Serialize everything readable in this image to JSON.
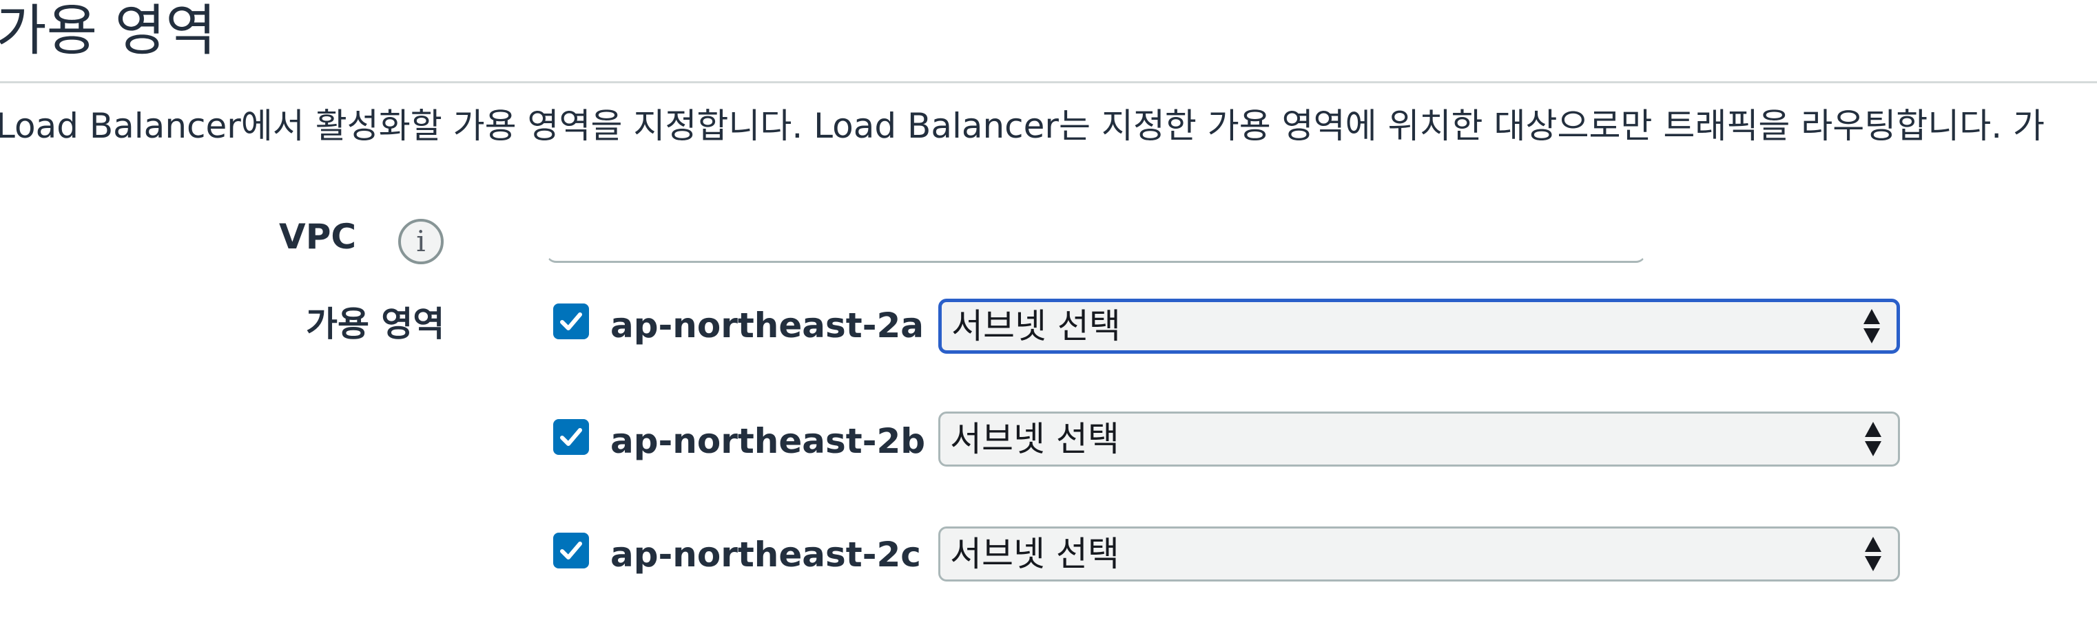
{
  "section": {
    "title": "가용 영역",
    "description": "Load Balancer에서 활성화할 가용 영역을 지정합니다. Load Balancer는 지정한 가용 영역에 위치한 대상으로만 트래픽을 라우팅합니다. 가"
  },
  "vpc": {
    "label": "VPC",
    "info_icon": "info-icon",
    "value": ""
  },
  "availability_zones": {
    "label": "가용 영역",
    "checkbox_color": "#0073bb",
    "focus_color": "#2a5fc9",
    "items": [
      {
        "name": "ap-northeast-2a",
        "checked": true,
        "subnet_placeholder": "서브넷 선택",
        "focused": true
      },
      {
        "name": "ap-northeast-2b",
        "checked": true,
        "subnet_placeholder": "서브넷 선택",
        "focused": false
      },
      {
        "name": "ap-northeast-2c",
        "checked": true,
        "subnet_placeholder": "서브넷 선택",
        "focused": false
      }
    ]
  }
}
